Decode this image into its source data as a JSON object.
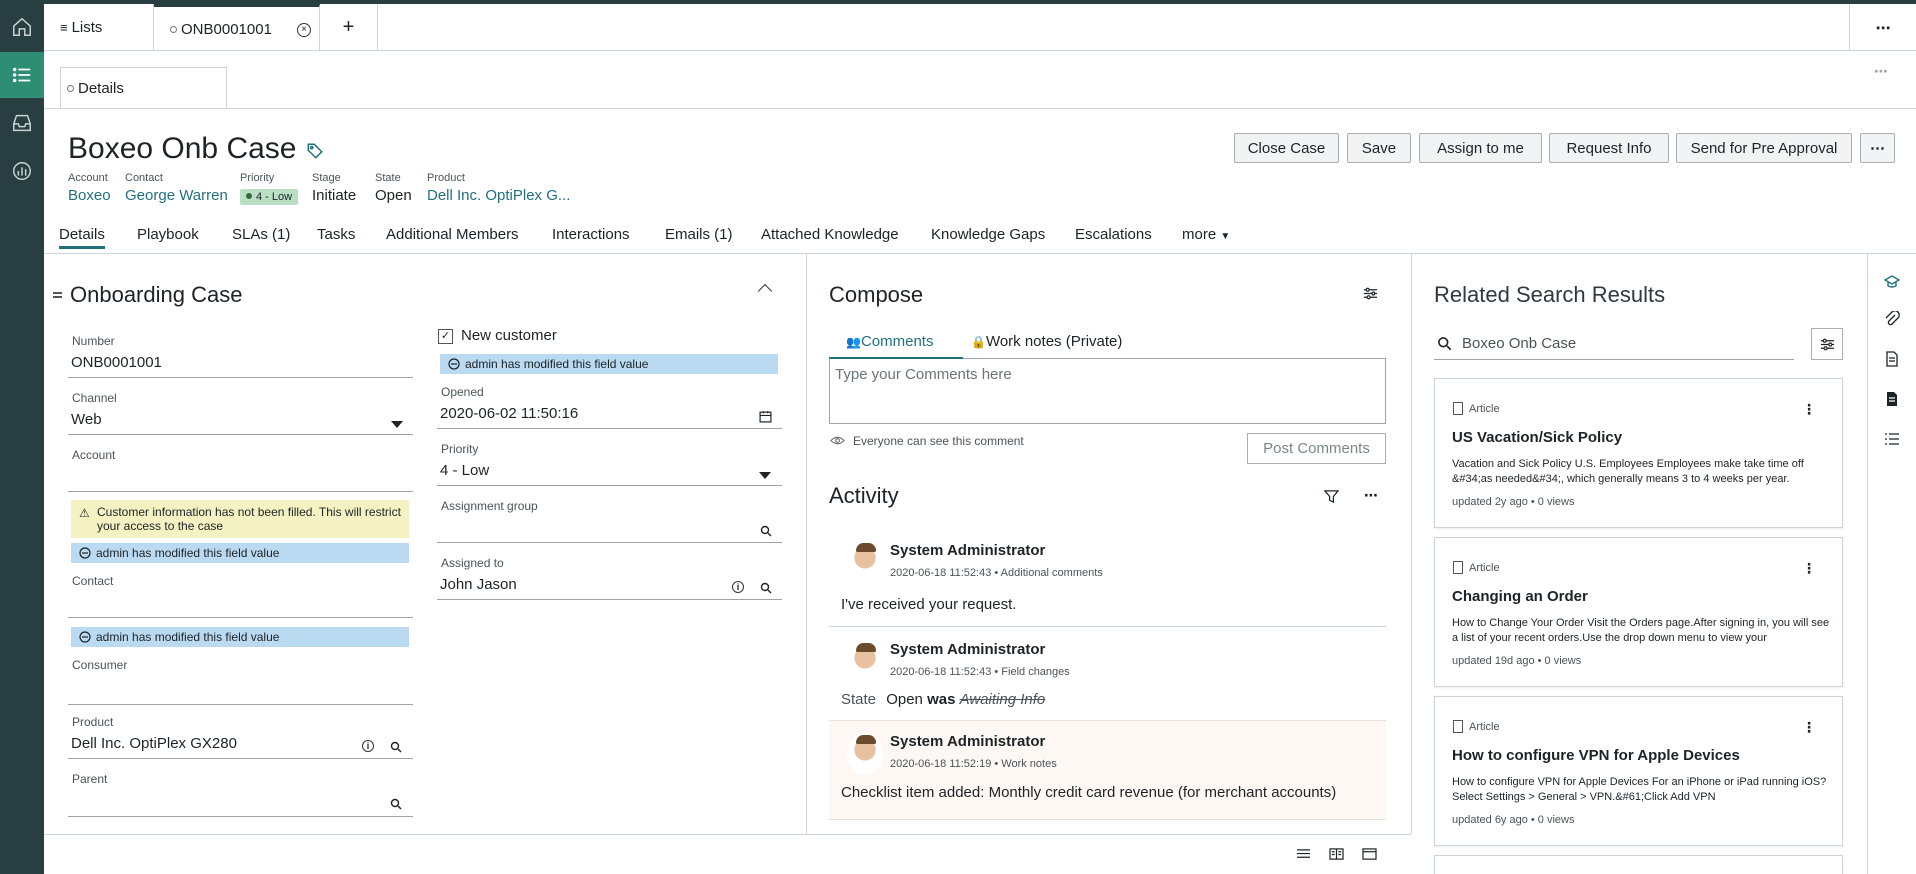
{
  "top_tabs": {
    "lists_label": "Lists",
    "record_label": "ONB0001001",
    "add_label": "+",
    "more_label": "⋯"
  },
  "form": {
    "details_tab": "Details",
    "overflow": "⋯",
    "title": "Boxeo Onb Case",
    "meta": [
      {
        "label": "Account",
        "value": "Boxeo"
      },
      {
        "label": "Contact",
        "value": "George Warren"
      },
      {
        "label": "Priority",
        "value": "4 - Low"
      },
      {
        "label": "Stage",
        "value": "Initiate"
      },
      {
        "label": "State",
        "value": "Open"
      },
      {
        "label": "Product",
        "value": "Dell Inc. OptiPlex G..."
      }
    ],
    "actions": [
      "Close Case",
      "Save",
      "Assign to me",
      "Request Info",
      "Send for Pre Approval",
      "⋯"
    ],
    "tabs": [
      "Details",
      "Playbook",
      "SLAs (1)",
      "Tasks",
      "Additional Members",
      "Interactions",
      "Emails (1)",
      "Attached Knowledge",
      "Knowledge Gaps",
      "Escalations",
      "more"
    ]
  },
  "section": {
    "title": "Onboarding Case",
    "number_label": "Number",
    "number_value": "ONB0001001",
    "channel_label": "Channel",
    "channel_value": "Web",
    "account_label": "Account",
    "warning": "Customer information has not been filled. This will restrict your access to the case",
    "modified_note": "admin has modified this field value",
    "contact_label": "Contact",
    "consumer_label": "Consumer",
    "product_label": "Product",
    "product_value": "Dell Inc. OptiPlex GX280",
    "parent_label": "Parent",
    "new_customer_label": "New customer",
    "opened_label": "Opened",
    "opened_value": "2020-06-02 11:50:16",
    "priority_label": "Priority",
    "priority_value": "4 - Low",
    "assignment_group_label": "Assignment group",
    "assigned_to_label": "Assigned to",
    "assigned_to_value": "John Jason"
  },
  "compose": {
    "title": "Compose",
    "tab_comments": "Comments",
    "tab_worknotes": "Work notes (Private)",
    "placeholder": "Type your Comments here",
    "visibility": "Everyone can see this comment",
    "post": "Post Comments"
  },
  "activity": {
    "title": "Activity",
    "entries": [
      {
        "author": "System Administrator",
        "meta": "2020-06-18 11:52:43 • Additional comments",
        "body": "I've received your request."
      },
      {
        "author": "System Administrator",
        "meta": "2020-06-18 11:52:43 • Field changes",
        "field": "State",
        "new": "Open",
        "was": "was",
        "old": "Awaiting Info"
      },
      {
        "author": "System Administrator",
        "meta": "2020-06-18 11:52:19 • Work notes",
        "body": "Checklist item added: Monthly credit card revenue (for merchant accounts)"
      }
    ]
  },
  "related": {
    "title": "Related Search Results",
    "search_value": "Boxeo Onb Case",
    "cards": [
      {
        "type": "Article",
        "title": "US Vacation/Sick Policy",
        "desc": "Vacation and Sick Policy U.S. Employees   Employees make take time off &#34;as needed&#34;, which generally means 3 to 4 weeks per year.",
        "foot": "updated 2y ago • 0 views"
      },
      {
        "type": "Article",
        "title": "Changing an Order",
        "desc": "How to Change Your Order Visit the Orders page.After signing in, you will see a list of your recent orders.Use the drop down menu to view your",
        "foot": "updated 19d ago • 0 views"
      },
      {
        "type": "Article",
        "title": "How to configure VPN for Apple Devices",
        "desc": "How to configure VPN for Apple Devices For an iPhone or iPad running iOS? Select Settings > General > VPN.&#61;Click Add VPN",
        "foot": "updated 6y ago • 0 views"
      }
    ]
  }
}
